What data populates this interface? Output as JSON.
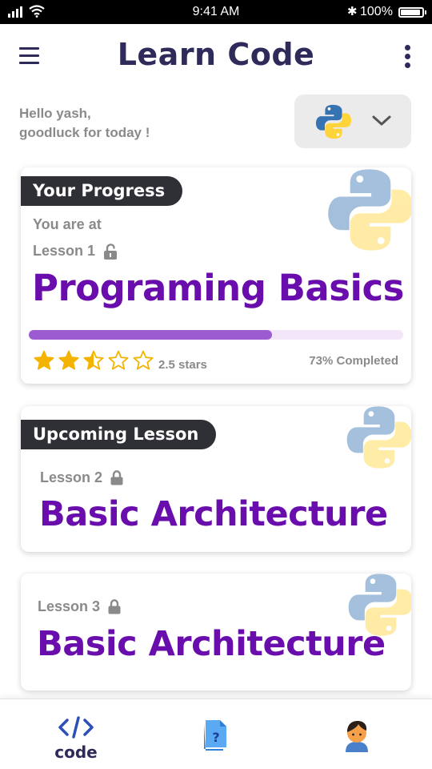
{
  "status_bar": {
    "time": "9:41 AM",
    "battery": "100%"
  },
  "header": {
    "title": "Learn Code",
    "menu_icon": "hamburger-icon",
    "more_icon": "vertical-dots-icon"
  },
  "greeting": {
    "line1": "Hello yash,",
    "line2": "goodluck for today !"
  },
  "language_selector": {
    "selected": "python-logo",
    "icon": "chevron-down-icon"
  },
  "progress_card": {
    "badge": "Your Progress",
    "intro": "You are at",
    "lesson": "Lesson 1",
    "lesson_icon": "unlocked-padlock-icon",
    "title": "Programing Basics",
    "progress_fraction": 0.65,
    "rating_value": 2.5,
    "rating_max": 5,
    "stars_label": "2.5 stars",
    "completed_label": "73% Completed"
  },
  "upcoming_card": {
    "badge": "Upcoming Lesson",
    "lesson": "Lesson 2",
    "lesson_icon": "locked-padlock-icon",
    "title": "Basic Architecture"
  },
  "next_card": {
    "lesson": "Lesson 3",
    "lesson_icon": "locked-padlock-icon",
    "title": "Basic Architecture"
  },
  "bottom_nav": {
    "items": [
      {
        "label": "code",
        "icon": "code-brackets-icon",
        "active": true
      },
      {
        "icon": "quiz-document-icon"
      },
      {
        "icon": "user-avatar-icon"
      }
    ]
  },
  "colors": {
    "accent": "#6a0dad",
    "title": "#2e2a5a",
    "badge": "#2f2f36",
    "star": "#f5b301",
    "progress_fill": "#9d5bd1"
  }
}
